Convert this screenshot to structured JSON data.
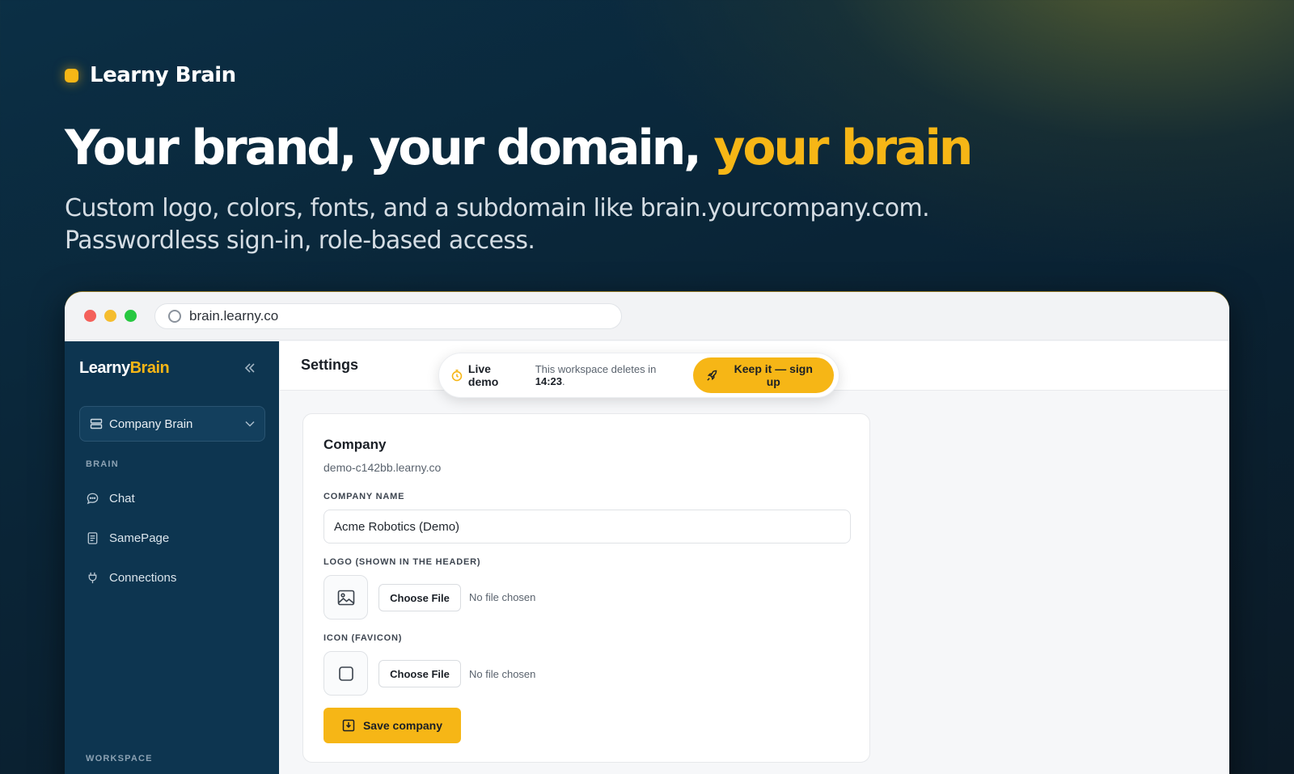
{
  "hero": {
    "brand_name": "Learny Brain",
    "headline_main": "Your brand, your domain, ",
    "headline_accent": "your brain",
    "subline_1": "Custom logo, colors, fonts, and a subdomain like brain.yourcompany.com.",
    "subline_2": "Passwordless sign-in, role-based access."
  },
  "browser": {
    "url": "brain.learny.co"
  },
  "sidebar": {
    "logo_part1": "Learny",
    "logo_part2": "Brain",
    "workspace_select": "Company Brain",
    "section_brain": "BRAIN",
    "items": [
      {
        "label": "Chat",
        "icon": "chat-icon"
      },
      {
        "label": "SamePage",
        "icon": "document-icon"
      },
      {
        "label": "Connections",
        "icon": "plug-icon"
      }
    ],
    "section_workspace": "WORKSPACE"
  },
  "topbar": {
    "title": "Settings",
    "demo_label": "Live demo",
    "demo_note": "This workspace deletes in ",
    "demo_time": "14:23",
    "demo_note_end": ".",
    "signup_label": "Keep it — sign up"
  },
  "company_card": {
    "title": "Company",
    "subdomain": "demo-c142bb.learny.co",
    "name_label": "COMPANY NAME",
    "name_value": "Acme Robotics (Demo)",
    "logo_label": "LOGO (SHOWN IN THE HEADER)",
    "icon_label": "ICON (FAVICON)",
    "choose_file": "Choose File",
    "no_file": "No file chosen",
    "save_label": "Save company"
  },
  "colors": {
    "accent": "#f6b616",
    "sidebar_bg": "#0d3550"
  }
}
